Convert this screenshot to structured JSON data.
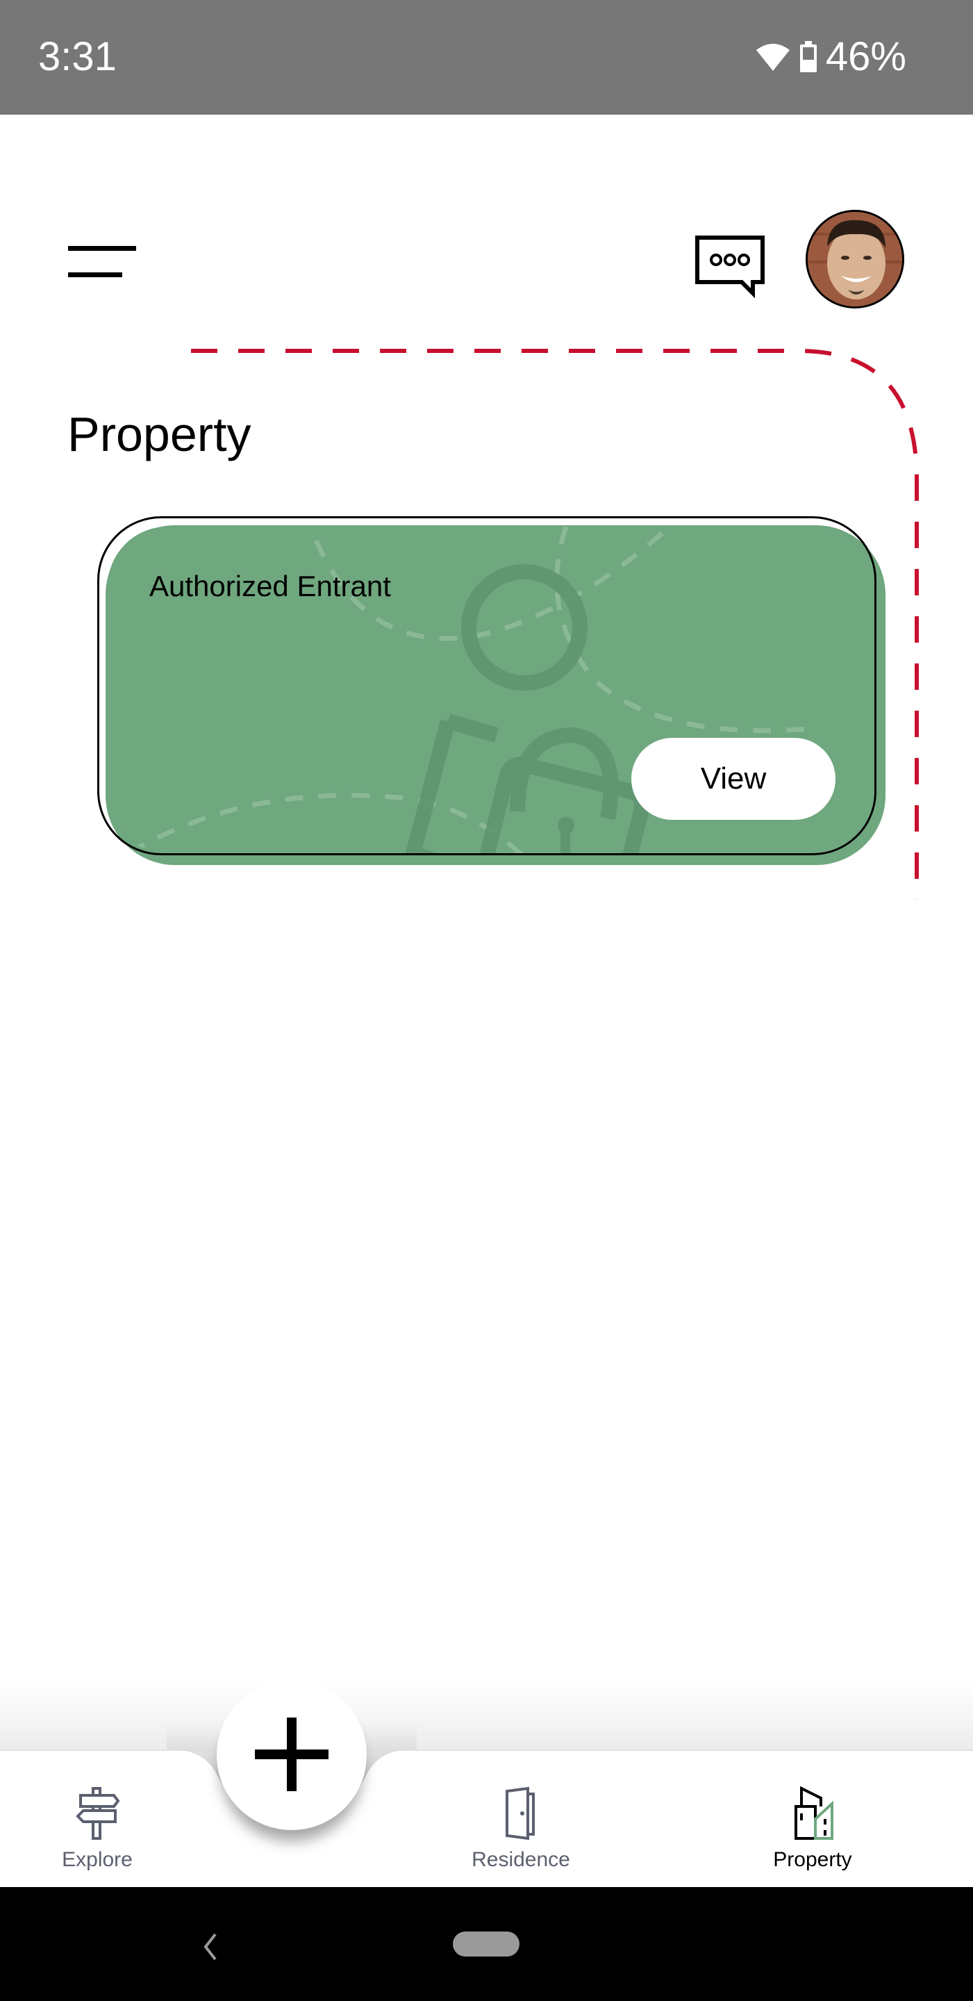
{
  "status_bar": {
    "time": "3:31",
    "wifi_icon": "wifi-icon",
    "battery_icon": "battery-icon",
    "battery_percent": "46%"
  },
  "header": {
    "menu_icon": "menu-icon",
    "chat_icon": "chat-bubble-icon",
    "avatar_alt": "User profile photo"
  },
  "page": {
    "title": "Property"
  },
  "card": {
    "title": "Authorized Entrant",
    "button_label": "View",
    "background_icon": "person-lock-icon",
    "color": "#6fa77f"
  },
  "colors": {
    "accent_dashed": "#c8102e",
    "card_green": "#6fa77f",
    "nav_inactive": "#5c5f6e"
  },
  "bottom_nav": {
    "fab_icon": "plus-icon",
    "items": [
      {
        "label": "Explore",
        "icon": "signpost-icon",
        "active": false
      },
      {
        "label": "Residence",
        "icon": "door-icon",
        "active": false
      },
      {
        "label": "Property",
        "icon": "buildings-icon",
        "active": true
      }
    ]
  },
  "system_nav": {
    "back_icon": "back-chevron-icon",
    "home_icon": "home-pill-icon"
  }
}
